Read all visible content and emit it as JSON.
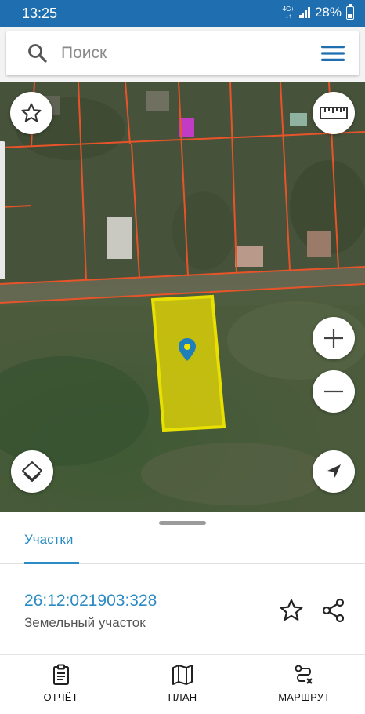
{
  "status_bar": {
    "time": "13:25",
    "network_top": "4G+",
    "network_bottom": "↓↑",
    "battery": "28%"
  },
  "search": {
    "placeholder": "Поиск",
    "value": ""
  },
  "icons": {
    "search": "search-icon",
    "menu": "hamburger-menu-icon",
    "favorite_map": "star-icon",
    "ruler": "ruler-icon",
    "zoom_in": "plus-icon",
    "zoom_out": "minus-icon",
    "layers": "layers-icon",
    "locate": "navigation-arrow-icon",
    "parcel_marker": "map-pin-icon",
    "report": "clipboard-icon",
    "plan": "map-icon",
    "route": "route-icon",
    "share": "share-icon"
  },
  "colors": {
    "accent": "#2b8bc4",
    "status_bar": "#1f6fb0",
    "parcel_boundary": "#e8542a",
    "selected_parcel_fill": "#f2e300",
    "selected_parcel_stroke": "#e8e000",
    "marker": "#1f7fb8"
  },
  "sheet": {
    "tab_label": "Участки",
    "cadastral_number": "26:12:021903:328",
    "parcel_type": "Земельный участок"
  },
  "bottom_nav": [
    {
      "label": "ОТЧЁТ"
    },
    {
      "label": "ПЛАН"
    },
    {
      "label": "МАРШРУТ"
    }
  ]
}
